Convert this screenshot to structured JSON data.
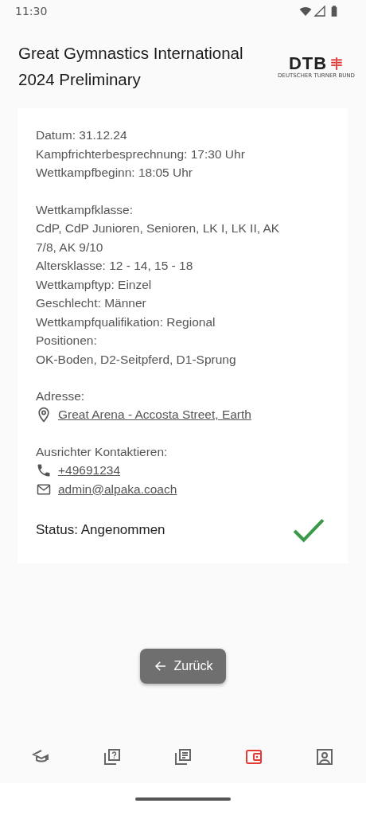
{
  "status_bar": {
    "time": "11:30"
  },
  "header": {
    "title": "Great Gymnastics International 2024 Preliminary",
    "logo": {
      "text": "DTB",
      "subtitle": "DEUTSCHER TURNER BUND"
    }
  },
  "details": {
    "groups": [
      {
        "lines": [
          {
            "kind": "text",
            "text": "Datum: 31.12.24"
          },
          {
            "kind": "text",
            "text": "Kampfrichterbesprechnung: 17:30 Uhr"
          },
          {
            "kind": "text",
            "text": "Wettkampfbeginn: 18:05 Uhr"
          }
        ]
      },
      {
        "lines": [
          {
            "kind": "text",
            "text": "Wettkampfklasse:"
          },
          {
            "kind": "text",
            "text": "CdP, CdP Junioren, Senioren, LK I, LK II, AK 7/8, AK 9/10"
          },
          {
            "kind": "text",
            "text": "Altersklasse: 12 - 14, 15 - 18"
          },
          {
            "kind": "text",
            "text": "Wettkampftyp: Einzel"
          },
          {
            "kind": "text",
            "text": "Geschlecht: Männer"
          },
          {
            "kind": "text",
            "text": "Wettkampfqualifikation: Regional"
          },
          {
            "kind": "text",
            "text": "Positionen:"
          },
          {
            "kind": "text",
            "text": "OK-Boden, D2-Seitpferd, D1-Sprung"
          }
        ]
      },
      {
        "lines": [
          {
            "kind": "text",
            "text": "Adresse:"
          },
          {
            "kind": "location",
            "text": "Great Arena - Accosta Street, Earth"
          }
        ]
      },
      {
        "lines": [
          {
            "kind": "text",
            "text": "Ausrichter Kontaktieren:"
          },
          {
            "kind": "phone",
            "text": "+49691234"
          },
          {
            "kind": "email",
            "text": "admin@alpaka.coach"
          }
        ]
      }
    ],
    "status": {
      "label": "Status: Angenommen",
      "accepted": true
    }
  },
  "back_button": {
    "label": "Zurück"
  },
  "bottom_nav": [
    {
      "kind": "cap",
      "selected": false
    },
    {
      "kind": "question",
      "selected": false
    },
    {
      "kind": "list",
      "selected": false
    },
    {
      "kind": "wallet",
      "selected": true
    },
    {
      "kind": "profile",
      "selected": false
    }
  ]
}
